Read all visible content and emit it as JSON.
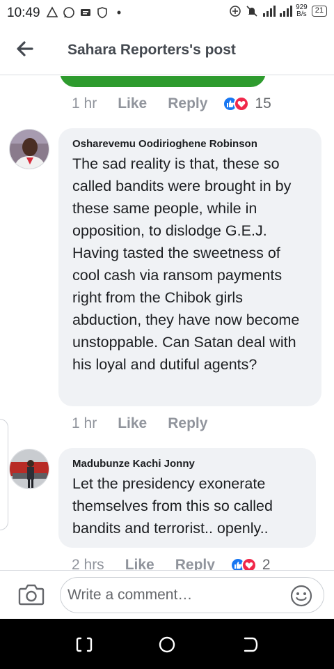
{
  "status_bar": {
    "time": "10:49",
    "net_speed_value": "929",
    "net_speed_unit": "B/s",
    "battery": "21",
    "left_icons": [
      "drive-icon",
      "whatsapp-icon",
      "message-icon",
      "shield-icon",
      "dot-icon"
    ],
    "right_icons": [
      "add-circle-icon",
      "mute-icon",
      "signal-icon",
      "signal-icon"
    ]
  },
  "header": {
    "title": "Sahara Reporters's post"
  },
  "previous_comment_actions": {
    "time": "1 hr",
    "like_label": "Like",
    "reply_label": "Reply",
    "reaction_count": "15"
  },
  "comments": [
    {
      "author": "Osharevemu Oodirioghene Robinson",
      "text": "The sad reality is that, these so called bandits were brought in by these same people, while in opposition, to dislodge G.E.J. Having tasted the sweetness of cool cash via ransom payments right from the Chibok girls abduction, they have now become unstoppable. Can Satan deal with his loyal and dutiful agents?",
      "time": "1 hr",
      "like_label": "Like",
      "reply_label": "Reply"
    },
    {
      "author": "Madubunze Kachi Jonny",
      "text": "Let the presidency exonerate themselves from this so called bandits and terrorist.. openly..",
      "time": "2 hrs",
      "like_label": "Like",
      "reply_label": "Reply",
      "reaction_count": "2"
    }
  ],
  "composer": {
    "placeholder": "Write a comment…"
  },
  "colors": {
    "like_blue": "#1877f2",
    "love_red": "#f0284a",
    "bubble_bg": "#f0f2f5",
    "meta_gray": "#90949c",
    "green_accent": "#2e9b2e"
  }
}
